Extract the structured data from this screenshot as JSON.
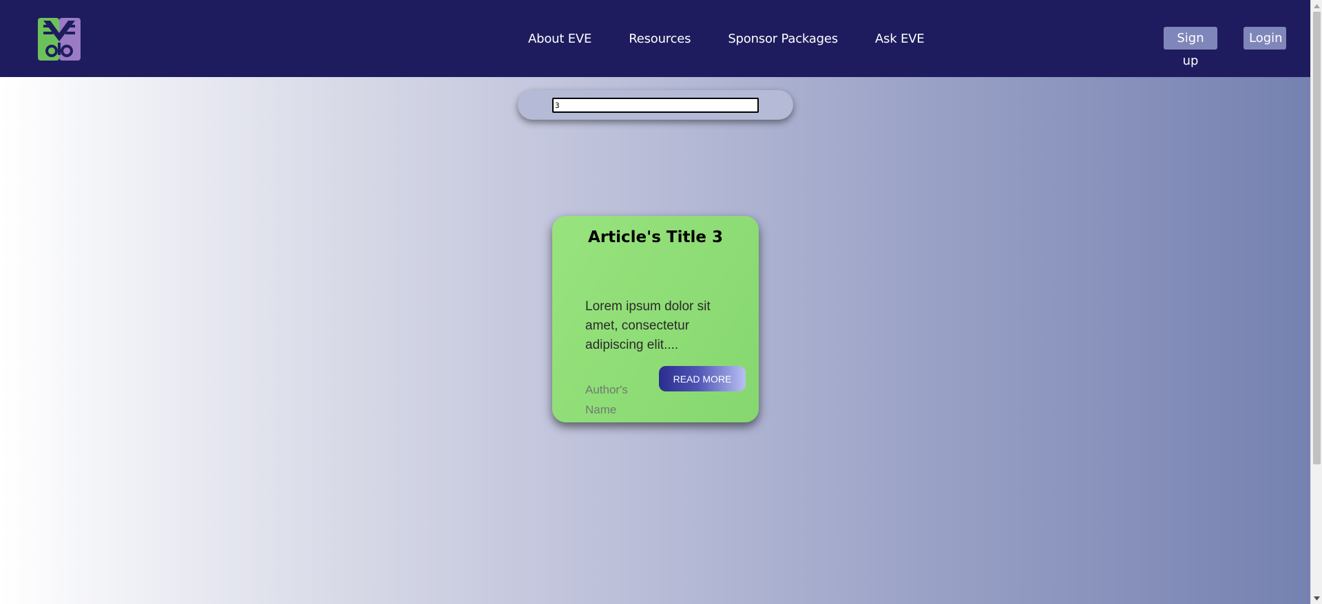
{
  "header": {
    "logo_icon": "eve-logo-icon",
    "nav": [
      {
        "label": "About EVE"
      },
      {
        "label": "Resources"
      },
      {
        "label": "Sponsor Packages"
      },
      {
        "label": "Ask EVE"
      }
    ],
    "signup_label": "Sign up",
    "login_label": "Login"
  },
  "search": {
    "value": "3"
  },
  "article": {
    "title": "Article's Title 3",
    "excerpt": "Lorem ipsum dolor sit amet, consectetur adipiscing elit....",
    "author": "Author's Name",
    "read_more_label": "READ MORE"
  },
  "colors": {
    "header_bg": "#1e1c5e",
    "auth_button_bg": "#7f86ba",
    "card_green": "#8fdd77",
    "read_more_start": "#2b2d8e",
    "read_more_end": "#b9c0f2"
  }
}
